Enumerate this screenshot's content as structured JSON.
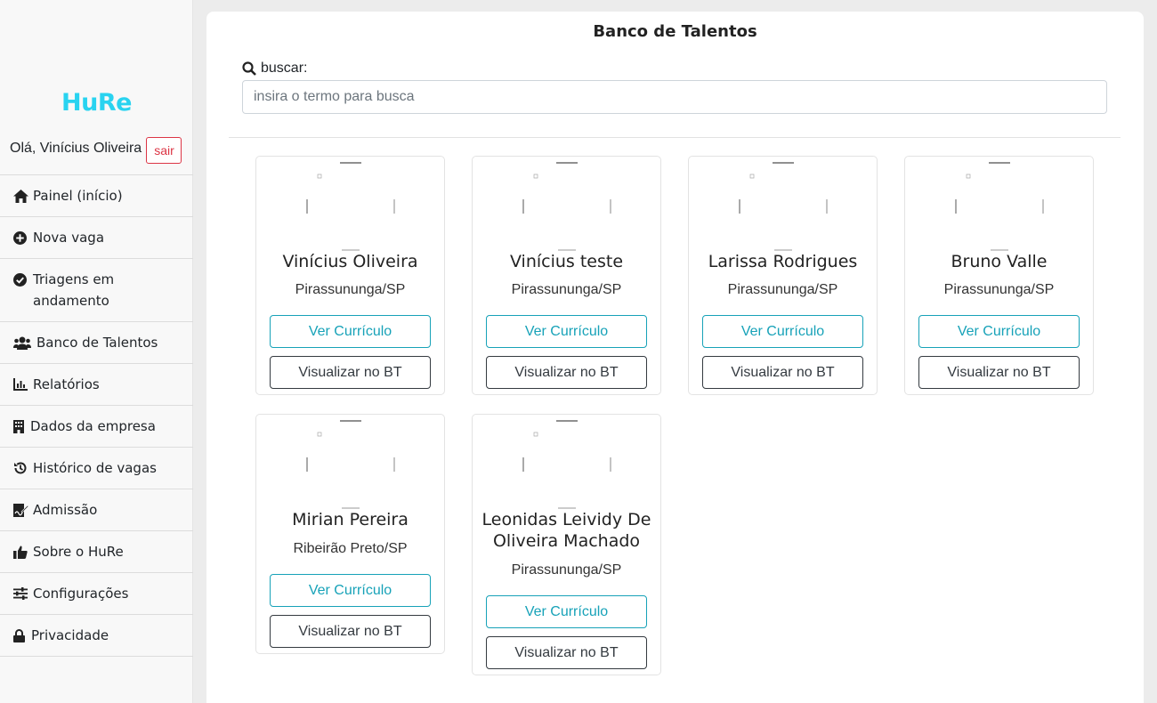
{
  "sidebar": {
    "logo": "HuRe",
    "greeting": "Olá, Vinícius Oliveira",
    "logout_label": "sair",
    "items": [
      {
        "label": "Painel (início)",
        "icon": "home-icon"
      },
      {
        "label": "Nova vaga",
        "icon": "plus-circle-icon"
      },
      {
        "label": "Triagens em andamento",
        "icon": "check-circle-icon"
      },
      {
        "label": "Banco de Talentos",
        "icon": "users-icon"
      },
      {
        "label": "Relatórios",
        "icon": "chart-icon"
      },
      {
        "label": "Dados da empresa",
        "icon": "building-icon"
      },
      {
        "label": "Histórico de vagas",
        "icon": "history-icon"
      },
      {
        "label": "Admissão",
        "icon": "signature-icon"
      },
      {
        "label": "Sobre o HuRe",
        "icon": "thumbs-up-icon"
      },
      {
        "label": "Configurações",
        "icon": "sliders-icon"
      },
      {
        "label": "Privacidade",
        "icon": "lock-icon"
      }
    ]
  },
  "main": {
    "title": "Banco de Talentos",
    "search": {
      "label": "buscar:",
      "placeholder": "insira o termo para busca",
      "value": ""
    },
    "candidates": [
      {
        "name": "Vinícius Oliveira",
        "city": "Pirassununga/SP",
        "cv_label": "Ver Currículo",
        "bt_label": "Visualizar no BT"
      },
      {
        "name": "Vinícius teste",
        "city": "Pirassununga/SP",
        "cv_label": "Ver Currículo",
        "bt_label": "Visualizar no BT"
      },
      {
        "name": "Larissa Rodrigues",
        "city": "Pirassununga/SP",
        "cv_label": "Ver Currículo",
        "bt_label": "Visualizar no BT"
      },
      {
        "name": "Bruno Valle",
        "city": "Pirassununga/SP",
        "cv_label": "Ver Currículo",
        "bt_label": "Visualizar no BT"
      },
      {
        "name": "Mirian Pereira",
        "city": "Ribeirão Preto/SP",
        "cv_label": "Ver Currículo",
        "bt_label": "Visualizar no BT"
      },
      {
        "name": "Leonidas Leividy De Oliveira Machado",
        "city": "Pirassununga/SP",
        "cv_label": "Ver Currículo",
        "bt_label": "Visualizar no BT"
      }
    ]
  },
  "colors": {
    "brand": "#29d3f0",
    "logout": "#dc3545",
    "cv_button": "#17a2b8",
    "bt_button": "#343a40"
  }
}
